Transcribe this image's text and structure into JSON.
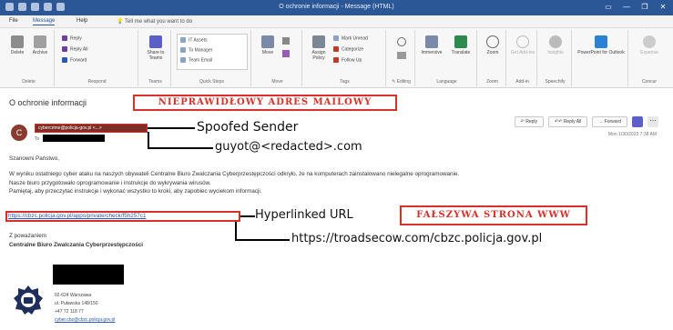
{
  "window": {
    "title": "O ochronie informacji - Message (HTML)",
    "controls": [
      "▭",
      "—",
      "❐",
      "✕"
    ]
  },
  "menu": {
    "items": [
      "File",
      "Message",
      "Help"
    ],
    "tell_me": "Tell me what you want to do"
  },
  "ribbon": {
    "groups": [
      {
        "label": "Delete",
        "buttons": [
          "Delete",
          "Archive"
        ]
      },
      {
        "label": "Respond",
        "buttons": [
          "Reply",
          "Reply All",
          "Forward"
        ]
      },
      {
        "label": "Teams",
        "buttons": [
          "Share to Teams"
        ]
      },
      {
        "label": "Quick Steps",
        "buttons": [
          "IT Assets",
          "To Manager",
          "Team Email"
        ]
      },
      {
        "label": "Move",
        "buttons": [
          "Move"
        ]
      },
      {
        "label": "Tags",
        "buttons": [
          "Assign Policy",
          "Mark Unread",
          "Categorize",
          "Follow Up"
        ]
      },
      {
        "label": "Editing",
        "buttons": []
      },
      {
        "label": "Language",
        "buttons": [
          "Immersive",
          "Translate"
        ]
      },
      {
        "label": "Zoom",
        "buttons": [
          "Zoom"
        ]
      },
      {
        "label": "Add-in",
        "buttons": [
          "Get Add-ins"
        ]
      },
      {
        "label": "Speechify",
        "buttons": [
          "Insights"
        ]
      },
      {
        "label": "",
        "buttons": [
          "PowerPoint for Outlook"
        ]
      },
      {
        "label": "Concur",
        "buttons": [
          "Expense"
        ]
      }
    ]
  },
  "email": {
    "subject": "O ochronie informacji",
    "from_display": "cybercrime@policja-gov.pl <...>",
    "to_label": "To",
    "actions": [
      "Reply",
      "Reply All",
      "Forward"
    ],
    "datetime": "Mon 1/30/2023 7:38 AM",
    "greeting": "Szanowni Państwo,",
    "body_lines": [
      "W wyniku ostatniego cyber ataku na naszych obywateli Centralne Biuro Zwalczania Cyberprzestępczości odkryło, że na komputerach zainstalowano nielegalne oprogramowanie.",
      "Nasze biuro przygotowało oprogramowanie i instrukcje do wykrywania wirusów.",
      "Pamiętaj, aby przeczytać instrukcje i wykonać wszystko to kroki, aby zapobiec wyciekom informacji."
    ],
    "link": "https://cbzc.policja.gov.pl/apps/private/check/f5h257c1",
    "closing": "Z poważaniem",
    "signature_org": "Centralne Biuro Zwalczania Cyberprzestępczości",
    "address": [
      "02-624 Warszawa",
      "ul. Puławska 148/150",
      "+47 72 118 77",
      "cyber.cbz@cbzc.policja.gov.pl"
    ]
  },
  "annotations": {
    "wrong_address": "NIEPRAWIDŁOWY ADRES MAILOWY",
    "spoofed_sender": "Spoofed Sender",
    "real_sender": "guyot@<redacted>.com",
    "hyperlinked_url": "Hyperlinked URL",
    "fake_site": "FAŁSZYWA STRONA WWW",
    "real_url": "https://troadsecow.com/cbzc.policja.gov.pl"
  },
  "colors": {
    "titlebar": "#2b5797",
    "annotation_red": "#d9302a",
    "link_blue": "#2a56b8"
  }
}
